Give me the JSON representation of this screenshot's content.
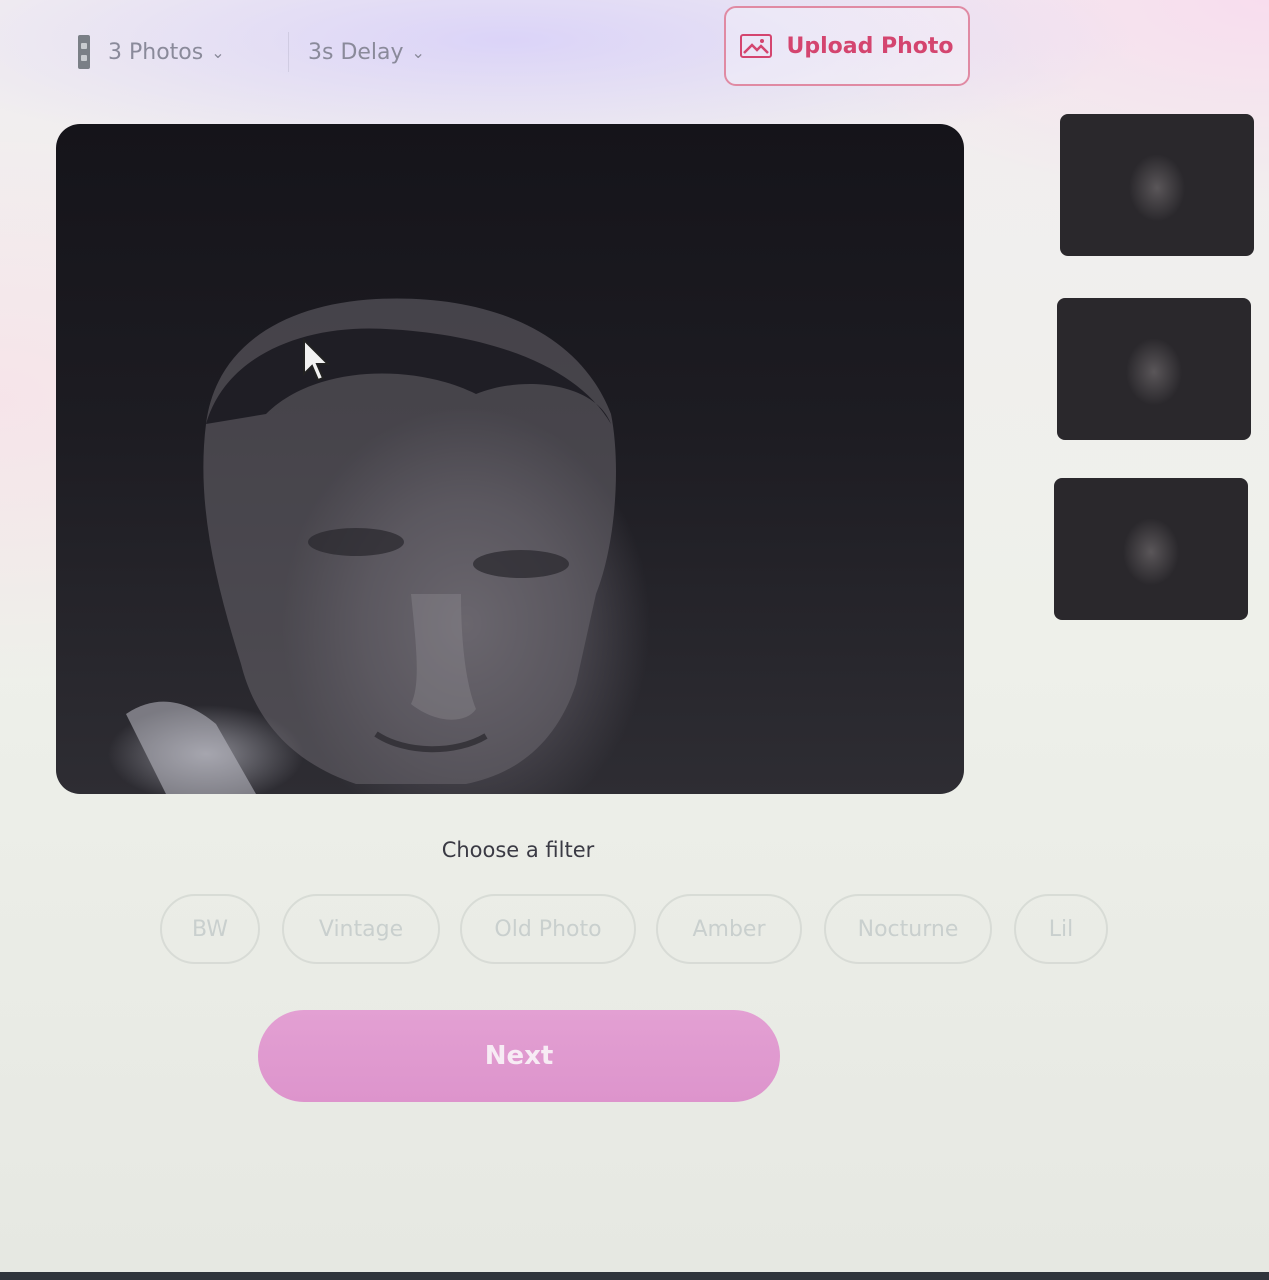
{
  "toolbar": {
    "photos_label": "3 Photos",
    "delay_label": "3s Delay",
    "upload_label": "Upload Photo"
  },
  "filter_section": {
    "title": "Choose a filter",
    "filters": [
      "BW",
      "Vintage",
      "Old Photo",
      "Amber",
      "Nocturne",
      "Lil"
    ]
  },
  "next_label": "Next",
  "icons": {
    "photos": "film-strip-icon",
    "dropdown": "chevron-down-icon",
    "upload": "image-icon",
    "cursor": "mouse-pointer-icon"
  },
  "colors": {
    "accent": "#d4456f",
    "next_button": "#df98cf",
    "viewer_bg": "#1b1a20"
  }
}
